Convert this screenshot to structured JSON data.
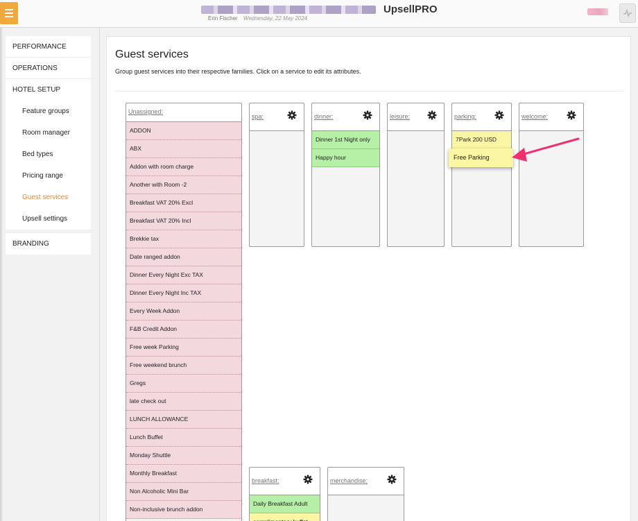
{
  "header": {
    "brand": "UpsellPRO",
    "user": "Erin Fischer",
    "date": "Wednesday, 22 May 2024"
  },
  "sidebar": {
    "performance": "PERFORMANCE",
    "operations": "OPERATIONS",
    "hotel_setup": "HOTEL SETUP",
    "items": [
      {
        "label": "Feature groups"
      },
      {
        "label": "Room manager"
      },
      {
        "label": "Bed types"
      },
      {
        "label": "Pricing range"
      },
      {
        "label": "Guest services"
      },
      {
        "label": "Upsell settings"
      }
    ],
    "branding": "BRANDING"
  },
  "page": {
    "title": "Guest services",
    "description": "Group guest services into their respective families. Click on a service to edit its attributes."
  },
  "unassigned": {
    "name": "Unassigned:",
    "items": [
      "ADDON",
      "ABX",
      "Addon with room charge",
      "Another with Room -2",
      "Breakfast VAT 20% Excl",
      "Breakfast VAT 20% Incl",
      "Brekkie tax",
      "Date ranged addon",
      "Dinner Every Night Exc TAX",
      "Dinner Every Night Inc TAX",
      "Every Week Addon",
      "F&B Credit Addon",
      "Free week Parking",
      "Free weekend brunch",
      "Gregs",
      "late check out",
      "LUNCH ALLOWANCE",
      "Lunch Buffet",
      "Monday Shuttle",
      "Monthly Breakfast",
      "Non Alcoholic Mini Bar",
      "Non-inclusive brunch addon"
    ]
  },
  "families": {
    "spa": {
      "name": "spa:"
    },
    "dinner": {
      "name": "dinner:",
      "items": [
        "Dinner 1st Night only",
        "Happy hour"
      ]
    },
    "leisure": {
      "name": "leisure:"
    },
    "parking": {
      "name": "parking:",
      "items": [
        "7Park 200 USD"
      ]
    },
    "welcome": {
      "name": "welcome:"
    },
    "breakfast": {
      "name": "breakfast:",
      "items": [
        "Daily Breakfast Adult",
        "complimentary buffet"
      ]
    },
    "merchandise": {
      "name": "merchandise:"
    }
  },
  "dragging_item": "Free Parking",
  "colors": {
    "accent": "#e8883a",
    "menu_button": "#f2a93b",
    "unassigned_item": "#f3d9dd",
    "family_green": "#b6f0a6",
    "family_yellow": "#fbf6a3",
    "annotation_arrow": "#f0306e"
  },
  "icons": {
    "menu": "hamburger-icon",
    "family_settings": "gear-icon",
    "activity": "activity-icon"
  }
}
